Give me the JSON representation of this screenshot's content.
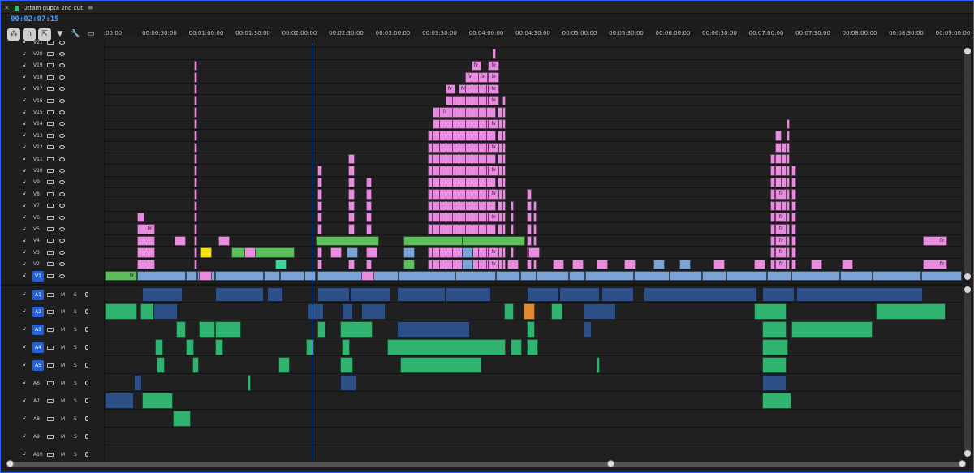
{
  "sequence": {
    "title": "Uttam gupta 2nd cut",
    "tab_color": "#31c26b",
    "close_glyph": "×",
    "menu_glyph": "≡",
    "timecode": "00:02:07:15",
    "playhead_seconds": 127.6
  },
  "toolbar": {
    "tools": [
      {
        "name": "insert-nest-tool",
        "glyph": "⁂",
        "active": true
      },
      {
        "name": "snap-magnet-tool",
        "glyph": "∩",
        "active": true
      },
      {
        "name": "linked-selection-tool",
        "glyph": "⇱",
        "active": true
      },
      {
        "name": "add-marker-tool",
        "glyph": "▼",
        "active": false
      },
      {
        "name": "wrench-settings-tool",
        "glyph": "🔧",
        "active": false
      },
      {
        "name": "captions-tool",
        "glyph": "▭",
        "active": false
      }
    ]
  },
  "ruler": {
    "labels": [
      ":00:00",
      "00:00:30:00",
      "00:01:00:00",
      "00:01:30:00",
      "00:02:00:00",
      "00:02:30:00",
      "00:03:00:00",
      "00:03:30:00",
      "00:04:00:00",
      "00:04:30:00",
      "00:05:00:00",
      "00:05:30:00",
      "00:06:00:00",
      "00:06:30:00",
      "00:07:00:00",
      "00:07:30:00",
      "00:08:00:00",
      "00:08:30:00",
      "00:09:00:00"
    ],
    "seconds_range": [
      0,
      560
    ],
    "work_area_color": "#b3a31b",
    "render_warning_color": "#d12b2b"
  },
  "video_tracks": [
    "V21",
    "V20",
    "V19",
    "V18",
    "V17",
    "V16",
    "V15",
    "V14",
    "V13",
    "V12",
    "V11",
    "V10",
    "V9",
    "V8",
    "V7",
    "V6",
    "V5",
    "V4",
    "V3",
    "V2",
    "V1"
  ],
  "audio_tracks": [
    "A1",
    "A2",
    "A3",
    "A4",
    "A5",
    "A6",
    "A7",
    "A8",
    "A9",
    "A10"
  ],
  "selected_tracks": [
    "V1",
    "A1",
    "A2",
    "A3",
    "A4",
    "A5"
  ],
  "audio_controls": {
    "mute": "M",
    "solo": "S"
  },
  "clip_colors": {
    "pink": "#e88ce0",
    "blue": "#7aa3d6",
    "green": "#5cbf5c",
    "yellow": "#f3e21a",
    "teal": "#3ed39a",
    "audio_navy": "#2c4f86",
    "audio_green": "#2fb36e",
    "audio_orange": "#e38a2e"
  }
}
